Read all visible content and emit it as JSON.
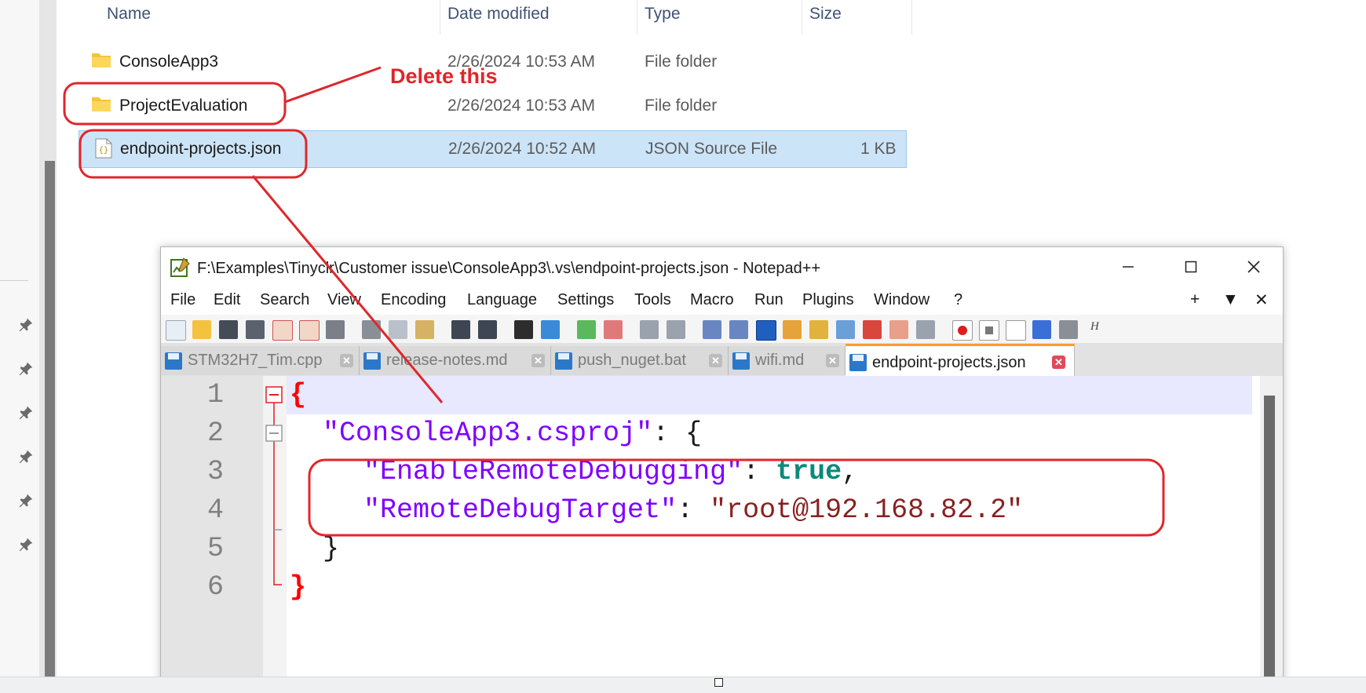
{
  "explorer": {
    "columns": {
      "name": "Name",
      "date": "Date modified",
      "type": "Type",
      "size": "Size"
    },
    "rows": [
      {
        "name": "ConsoleApp3",
        "date": "2/26/2024 10:53 AM",
        "type": "File folder",
        "size": "",
        "icon": "folder-icon"
      },
      {
        "name": "ProjectEvaluation",
        "date": "2/26/2024 10:53 AM",
        "type": "File folder",
        "size": "",
        "icon": "folder-icon"
      },
      {
        "name": "endpoint-projects.json",
        "date": "2/26/2024 10:52 AM",
        "type": "JSON Source File",
        "size": "1 KB",
        "icon": "json-file-icon",
        "selected": true
      }
    ],
    "pin_icon": "pin-icon"
  },
  "annotation": {
    "text": "Delete this",
    "color": "#e0262b"
  },
  "notepad": {
    "title": "F:\\Examples\\Tinyclr\\Customer issue\\ConsoleApp3\\.vs\\endpoint-projects.json - Notepad++",
    "app_icon": "notepad-plus-plus-icon",
    "window_buttons": [
      "minimize-icon",
      "maximize-icon",
      "close-icon"
    ],
    "menu": [
      "File",
      "Edit",
      "Search",
      "View",
      "Encoding",
      "Language",
      "Settings",
      "Tools",
      "Macro",
      "Run",
      "Plugins",
      "Window",
      "?"
    ],
    "menu_controls": [
      "+",
      "▼",
      "✕"
    ],
    "tabs": [
      {
        "label": "STM32H7_Tim.cpp",
        "active": false
      },
      {
        "label": "release-notes.md",
        "active": false
      },
      {
        "label": "push_nuget.bat",
        "active": false
      },
      {
        "label": "wifi.md",
        "active": false
      },
      {
        "label": "endpoint-projects.json",
        "active": true
      }
    ],
    "lines": [
      "1",
      "2",
      "3",
      "4",
      "5",
      "6"
    ],
    "code": {
      "l1_brace": "{",
      "l2_key": "\"ConsoleApp3.csproj\"",
      "l2_rest": ": {",
      "l3_key": "\"EnableRemoteDebugging\"",
      "l3_colon": ": ",
      "l3_val": "true",
      "l3_comma": ",",
      "l4_key": "\"RemoteDebugTarget\"",
      "l4_colon": ": ",
      "l4_val": "\"root@192.168.82.2\"",
      "l5": "}",
      "l6_brace": "}"
    },
    "colors": {
      "key": "#7f00ff",
      "string_value": "#8a1f1f",
      "keyword": "#0a8a7a",
      "brace": "#ff0000",
      "active_tab_accent": "#fe9a2e"
    }
  }
}
